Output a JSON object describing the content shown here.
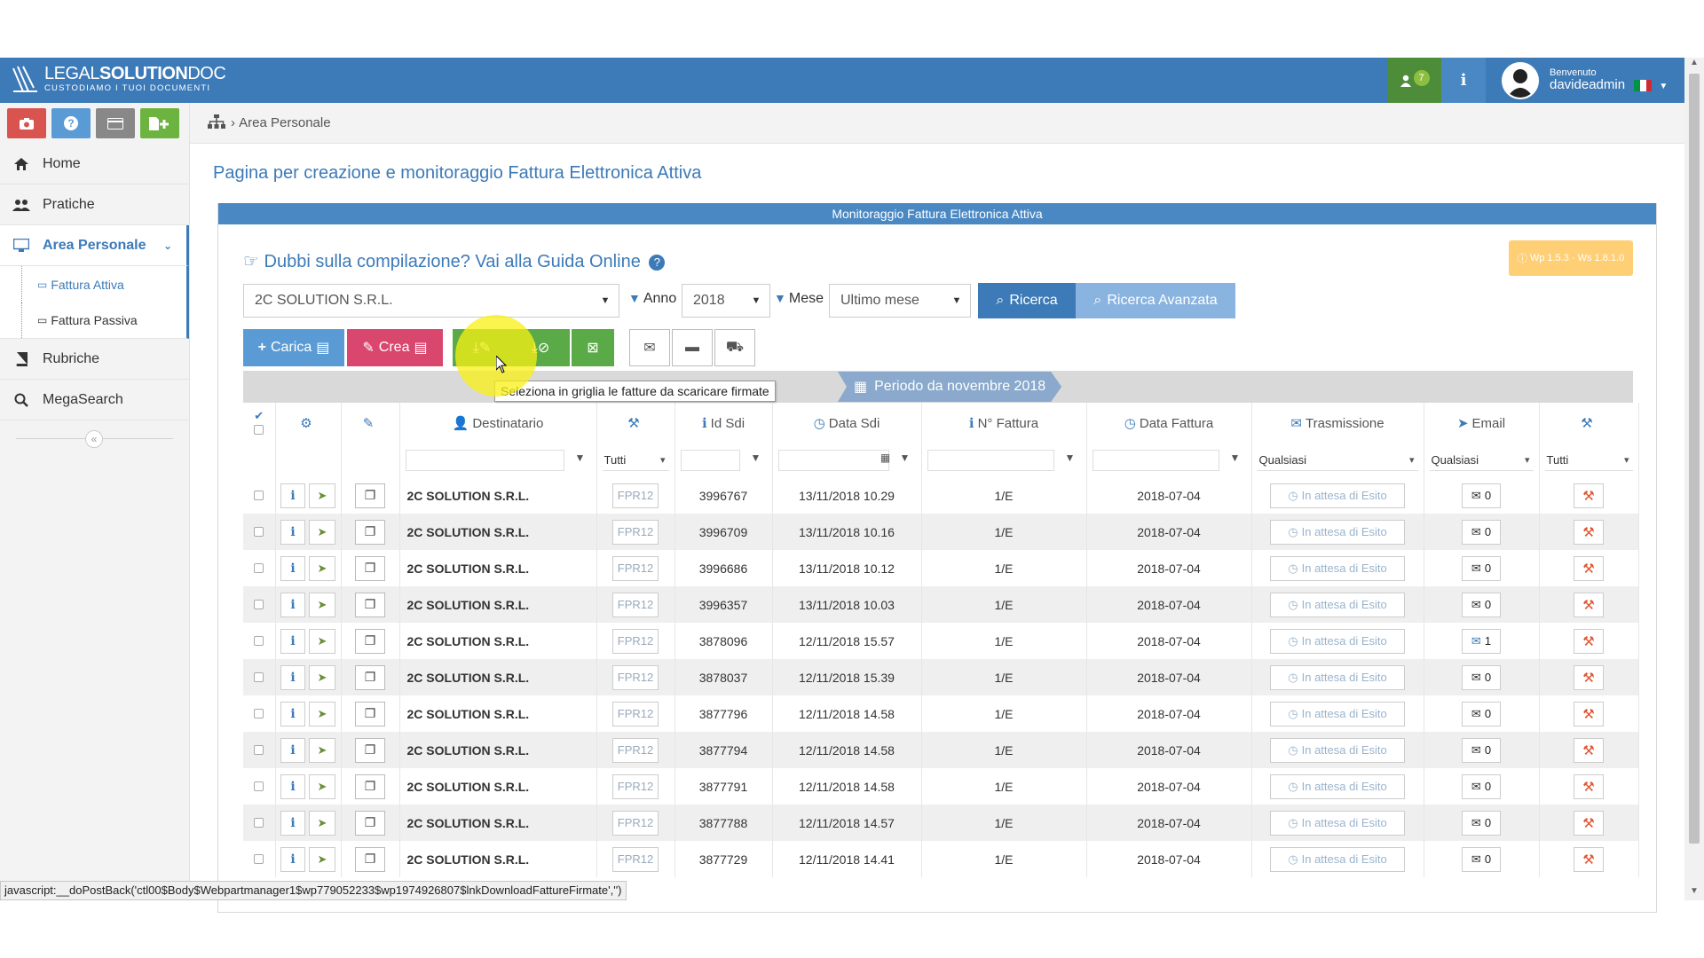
{
  "header": {
    "logo_main_light": "LEGAL",
    "logo_main_bold": "SOLUTION",
    "logo_main_tail": "DOC",
    "logo_sub": "CUSTODIAMO I TUOI DOCUMENTI",
    "notifications_count": "7",
    "info_label": "i",
    "welcome": "Benvenuto",
    "username": "davideadmin"
  },
  "quick_buttons": [
    {
      "icon": "camera-icon",
      "color": "#d9534f"
    },
    {
      "icon": "help-icon",
      "color": "#5b9bd5"
    },
    {
      "icon": "card-icon",
      "color": "#888888"
    },
    {
      "icon": "add-document-icon",
      "color": "#6cb33f"
    }
  ],
  "sidebar": {
    "items": [
      {
        "label": "Home",
        "icon": "home-icon"
      },
      {
        "label": "Pratiche",
        "icon": "users-icon"
      },
      {
        "label": "Area Personale",
        "icon": "monitor-icon"
      },
      {
        "label": "Rubriche",
        "icon": "book-icon"
      },
      {
        "label": "MegaSearch",
        "icon": "search-icon"
      }
    ],
    "sub_items": [
      {
        "label": "Fattura Attiva"
      },
      {
        "label": "Fattura Passiva"
      }
    ]
  },
  "breadcrumb": {
    "current": "Area Personale"
  },
  "page": {
    "title": "Pagina per creazione e monitoraggio Fattura Elettronica Attiva"
  },
  "panel": {
    "title": "Monitoraggio Fattura Elettronica Attiva",
    "guide_text": "Dubbi sulla compilazione? Vai alla Guida Online",
    "version": "Wp 1.5.3 · Ws 1.8.1.0"
  },
  "filters": {
    "company": "2C SOLUTION S.R.L.",
    "anno_label": "Anno",
    "anno_value": "2018",
    "mese_label": "Mese",
    "mese_value": "Ultimo mese",
    "search_btn": "Ricerca",
    "advanced_btn": "Ricerca Avanzata"
  },
  "toolbar": {
    "carica": "Carica",
    "crea": "Crea"
  },
  "tooltip": "Seleziona in griglia le fatture da scaricare firmate",
  "period": "Periodo da novembre 2018",
  "table": {
    "columns": {
      "destinatario": "Destinatario",
      "id_sdi": "Id Sdi",
      "data_sdi": "Data Sdi",
      "numero_fattura": "N° Fattura",
      "data_fattura": "Data Fattura",
      "trasmissione": "Trasmissione",
      "email": "Email"
    },
    "filters": {
      "format": "Tutti",
      "trasmissione": "Qualsiasi",
      "email": "Qualsiasi",
      "action": "Tutti"
    },
    "rows": [
      {
        "dest": "2C SOLUTION S.R.L.",
        "fmt": "FPR12",
        "id": "3996767",
        "datasdi": "13/11/2018 10.29",
        "num": "1/E",
        "datafatt": "2018-07-04",
        "stato": "In attesa di Esito",
        "email": "0"
      },
      {
        "dest": "2C SOLUTION S.R.L.",
        "fmt": "FPR12",
        "id": "3996709",
        "datasdi": "13/11/2018 10.16",
        "num": "1/E",
        "datafatt": "2018-07-04",
        "stato": "In attesa di Esito",
        "email": "0"
      },
      {
        "dest": "2C SOLUTION S.R.L.",
        "fmt": "FPR12",
        "id": "3996686",
        "datasdi": "13/11/2018 10.12",
        "num": "1/E",
        "datafatt": "2018-07-04",
        "stato": "In attesa di Esito",
        "email": "0"
      },
      {
        "dest": "2C SOLUTION S.R.L.",
        "fmt": "FPR12",
        "id": "3996357",
        "datasdi": "13/11/2018 10.03",
        "num": "1/E",
        "datafatt": "2018-07-04",
        "stato": "In attesa di Esito",
        "email": "0"
      },
      {
        "dest": "2C SOLUTION S.R.L.",
        "fmt": "FPR12",
        "id": "3878096",
        "datasdi": "12/11/2018 15.57",
        "num": "1/E",
        "datafatt": "2018-07-04",
        "stato": "In attesa di Esito",
        "email": "1"
      },
      {
        "dest": "2C SOLUTION S.R.L.",
        "fmt": "FPR12",
        "id": "3878037",
        "datasdi": "12/11/2018 15.39",
        "num": "1/E",
        "datafatt": "2018-07-04",
        "stato": "In attesa di Esito",
        "email": "0"
      },
      {
        "dest": "2C SOLUTION S.R.L.",
        "fmt": "FPR12",
        "id": "3877796",
        "datasdi": "12/11/2018 14.58",
        "num": "1/E",
        "datafatt": "2018-07-04",
        "stato": "In attesa di Esito",
        "email": "0"
      },
      {
        "dest": "2C SOLUTION S.R.L.",
        "fmt": "FPR12",
        "id": "3877794",
        "datasdi": "12/11/2018 14.58",
        "num": "1/E",
        "datafatt": "2018-07-04",
        "stato": "In attesa di Esito",
        "email": "0"
      },
      {
        "dest": "2C SOLUTION S.R.L.",
        "fmt": "FPR12",
        "id": "3877791",
        "datasdi": "12/11/2018 14.58",
        "num": "1/E",
        "datafatt": "2018-07-04",
        "stato": "In attesa di Esito",
        "email": "0"
      },
      {
        "dest": "2C SOLUTION S.R.L.",
        "fmt": "FPR12",
        "id": "3877788",
        "datasdi": "12/11/2018 14.57",
        "num": "1/E",
        "datafatt": "2018-07-04",
        "stato": "In attesa di Esito",
        "email": "0"
      },
      {
        "dest": "2C SOLUTION S.R.L.",
        "fmt": "FPR12",
        "id": "3877729",
        "datasdi": "12/11/2018 14.41",
        "num": "1/E",
        "datafatt": "2018-07-04",
        "stato": "In attesa di Esito",
        "email": "0"
      }
    ]
  },
  "statusbar": "javascript:__doPostBack('ctl00$Body$Webpartmanager1$wp779052233$wp1974926807$lnkDownloadFattureFirmate','')"
}
